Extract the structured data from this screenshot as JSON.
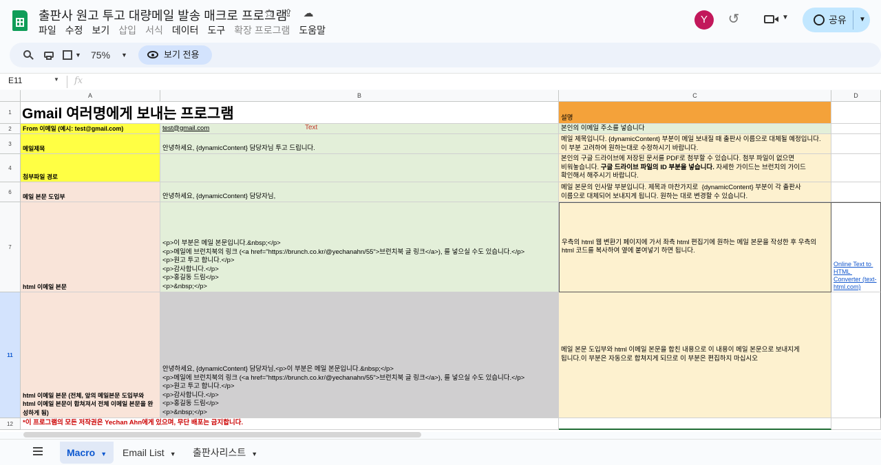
{
  "app": {
    "doc_title": "출판사 원고 투고 대량메일 발송 매크로 프로그램",
    "menu": [
      {
        "label": "파일",
        "dim": false
      },
      {
        "label": "수정",
        "dim": false
      },
      {
        "label": "보기",
        "dim": false
      },
      {
        "label": "삽입",
        "dim": true
      },
      {
        "label": "서식",
        "dim": true
      },
      {
        "label": "데이터",
        "dim": false
      },
      {
        "label": "도구",
        "dim": false
      },
      {
        "label": "확장 프로그램",
        "dim": true
      },
      {
        "label": "도움말",
        "dim": false
      }
    ],
    "avatar_letter": "Y",
    "share_label": "공유"
  },
  "toolbar": {
    "zoom": "75%",
    "view_only_label": "보기 전용"
  },
  "formula": {
    "cell_ref": "E11",
    "fx": "fx"
  },
  "grid": {
    "columns": [
      "A",
      "B",
      "C",
      "D"
    ],
    "rows": [
      "1",
      "2",
      "3",
      "4",
      "6",
      "7",
      "11",
      "12"
    ],
    "cells": {
      "A1": "Gmail 여러명에게 보내는 프로그램",
      "C1": "설명",
      "A2": "From 이메일 (예시: test@gmail.com)",
      "B2": "test@gmail.com",
      "B2_note": "Text",
      "C2": "본인의 이메일 주소를 넣습니다",
      "A3": "메일제목",
      "B3": "안녕하세요, {dynamicContent} 담당자님 투고 드립니다.",
      "C3": "메일 제목입니다. {dynamicContent} 부분이 메일 보내질 때 출판사 이름으로 대체될 예정입니다.\n이 부분 고려하여 원하는대로 수정하시기 바랍니다.",
      "A4": "첨부파일 경로",
      "B4": "",
      "C4_pre": "본인의 구글 드라이브에 저장된 문서를 PDF로 첨부할 수 있습니다. 첨부 파일이 없으면\n비워놓습니다. ",
      "C4_bold": "구글 드라이브 파일의 ID 부분을 넣습니다.",
      "C4_post": " 자세한 가이드는 브런치의 가이드\n확인해서 해주시기 바랍니다.",
      "A6": "메일 본문 도입부",
      "B6": "안녕하세요, {dynamicContent} 담당자님,",
      "C6": "메일 본문의 인사말 부분입니다. 제목과 마찬가지로  {dynamicContent} 부분이 각 출판사\n이름으로 대체되어 보내지게 됩니다. 원하는 대로 변경할 수 있습니다.",
      "A7": "html 이메일 본문",
      "B7": "<p>이 부분은 메일 본문입니다.&nbsp;</p>\n<p>메일에 브런치북의 링크 (<a href=\"https://brunch.co.kr/@yechanahn/55\">브런치북 글 링크</a>), 를 넣으실 수도 있습니다.</p>\n<p>원고 투고 합니다.</p>\n<p>감사합니다.</p>\n<p>홍길동 드림</p>\n<p>&nbsp;</p>",
      "C7": "우측의 html 웹 변환기 페이지에 가서 좌측 html 편집기에 원하는 메일 본문을 작성한 후 우측의\nhtml 코드를 복사하여 옆에 붙여넣기 하면 됩니다.",
      "D7": "Online Text to HTML Converter (text-html.com)",
      "A11": "html 이메일 본문 (전체, 앞의 메일본문 도입부와 html 이메일 본문이 합쳐져서 전체 이메일 본문을 완성하게 됨)",
      "B11": "안녕하세요, {dynamicContent} 담당자님,<p>이 부분은 메일 본문입니다.&nbsp;</p>\n<p>메일에 브런치북의 링크 (<a href=\"https://brunch.co.kr/@yechanahn/55\">브런치북 글 링크</a>), 를 넣으실 수도 있습니다.</p>\n<p>원고 투고 합니다.</p>\n<p>감사합니다.</p>\n<p>홍길동 드림</p>\n<p>&nbsp;</p>",
      "C11": "메일 본문 도입부와 html 이메일 본문을 합친 내용으로 이 내용이 메일 본문으로 보내지게\n됩니다.이 부분은 자동으로 합쳐지게 되므로 이 부분은 편집하지 마십시오",
      "A12": "*이 프로그램의 모든 저작권은 Yechan Ahn에게 있으며, 무단 배포는 금지합니다."
    }
  },
  "sheets": [
    {
      "label": "Macro",
      "active": true
    },
    {
      "label": "Email List",
      "active": false
    },
    {
      "label": "출판사리스트",
      "active": false
    }
  ]
}
